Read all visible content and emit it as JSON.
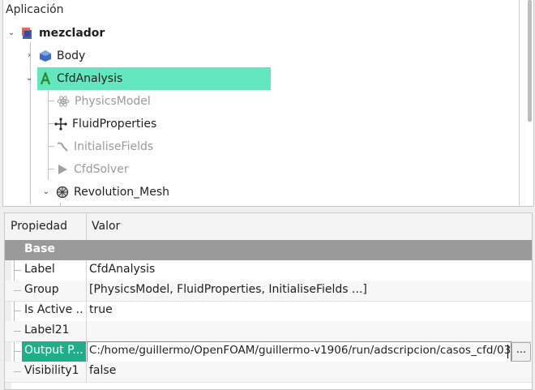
{
  "tree": {
    "header": "Aplicación",
    "items": [
      {
        "label": "mezclador",
        "icon": "document-cube-icon"
      },
      {
        "label": "Body",
        "icon": "body-icon"
      },
      {
        "label": "CfdAnalysis",
        "icon": "cfd-analysis-icon"
      },
      {
        "label": "PhysicsModel",
        "icon": "physics-model-icon"
      },
      {
        "label": "FluidProperties",
        "icon": "fluid-properties-icon"
      },
      {
        "label": "InitialiseFields",
        "icon": "initialise-fields-icon"
      },
      {
        "label": "CfdSolver",
        "icon": "cfd-solver-icon"
      },
      {
        "label": "Revolution_Mesh",
        "icon": "mesh-icon"
      }
    ]
  },
  "props": {
    "headers": {
      "property": "Propiedad",
      "value": "Valor"
    },
    "group": "Base",
    "rows": [
      {
        "name": "Label",
        "value": "CfdAnalysis"
      },
      {
        "name": "Group",
        "value": "[PhysicsModel, FluidProperties, InitialiseFields ...]"
      },
      {
        "name": "Is Active ...",
        "value": "true"
      },
      {
        "name": "Label21",
        "value": ""
      },
      {
        "name": "Output P...",
        "value": "C:/home/guillermo/OpenFOAM/guillermo-v1906/run/adscripcion/casos_cfd/03"
      },
      {
        "name": "Visibility1",
        "value": "false"
      }
    ],
    "browse_button": "..."
  },
  "colors": {
    "selection": "#64e6be",
    "selected_property": "#1fad8a",
    "group_header": "#9a9a9a"
  }
}
